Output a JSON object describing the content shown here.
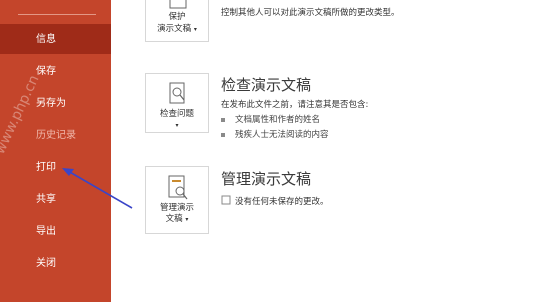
{
  "sidebar": {
    "items": [
      {
        "label": "信息",
        "selected": true,
        "disabled": false
      },
      {
        "label": "保存",
        "selected": false,
        "disabled": false
      },
      {
        "label": "另存为",
        "selected": false,
        "disabled": false
      },
      {
        "label": "历史记录",
        "selected": false,
        "disabled": true
      },
      {
        "label": "打印",
        "selected": false,
        "disabled": false
      },
      {
        "label": "共享",
        "selected": false,
        "disabled": false
      },
      {
        "label": "导出",
        "selected": false,
        "disabled": false
      },
      {
        "label": "关闭",
        "selected": false,
        "disabled": false
      }
    ]
  },
  "protect": {
    "tile_line1": "保护",
    "tile_line2": "演示文稿",
    "desc": "控制其他人可以对此演示文稿所做的更改类型。"
  },
  "inspect": {
    "tile_line1": "检查问题",
    "title": "检查演示文稿",
    "desc": "在发布此文件之前，请注意其是否包含:",
    "bullets": [
      "文档属性和作者的姓名",
      "残疾人士无法阅读的内容"
    ]
  },
  "manage": {
    "tile_line1": "管理演示",
    "tile_line2": "文稿",
    "title": "管理演示文稿",
    "desc": "没有任何未保存的更改。"
  },
  "watermark": "www.php.cn",
  "colors": {
    "sidebar_bg": "#c4452b",
    "sidebar_selected": "#9f2b18",
    "annotation_arrow": "#3a45c8"
  }
}
